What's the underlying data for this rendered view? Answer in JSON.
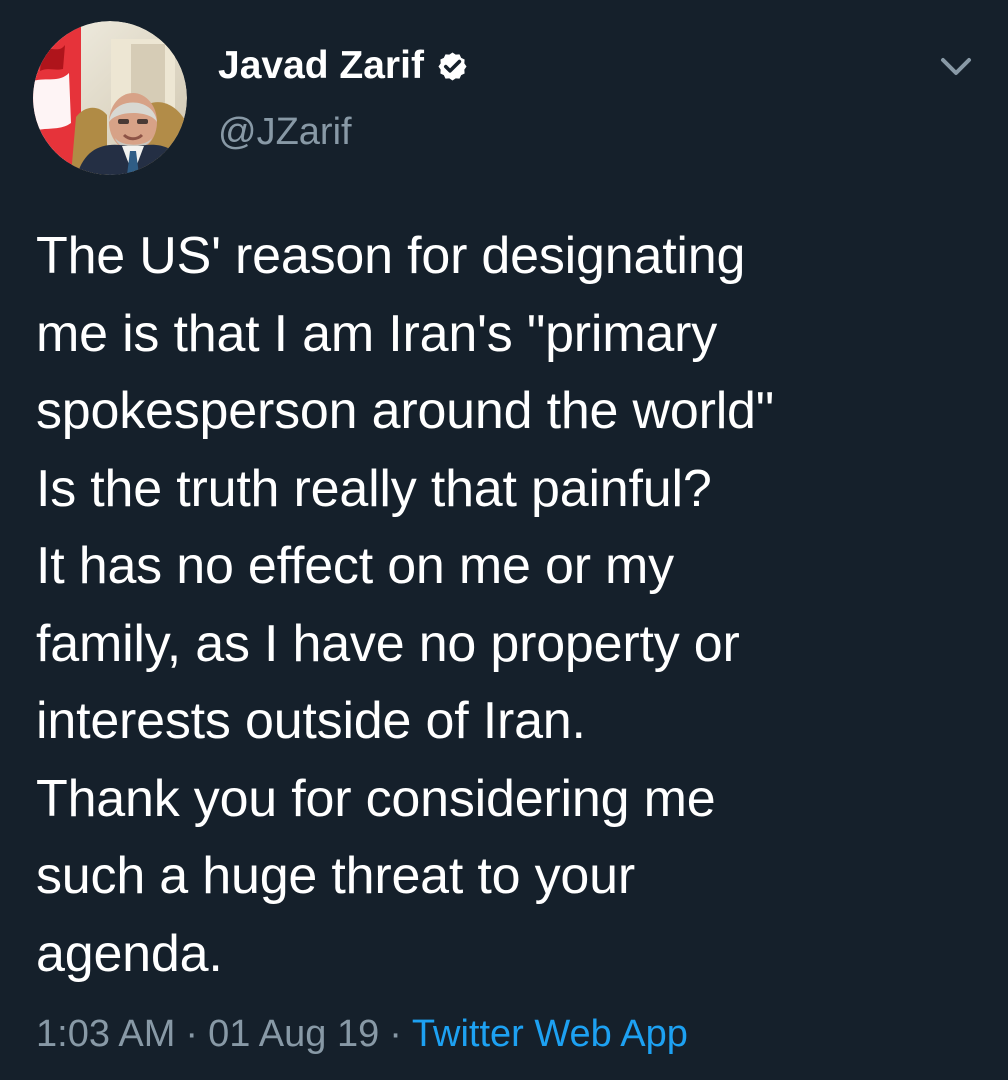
{
  "colors": {
    "background": "#15202b",
    "primary_text": "#ffffff",
    "secondary_text": "#8899a6",
    "link": "#1da1f2"
  },
  "tweet": {
    "author": {
      "display_name": "Javad Zarif",
      "handle": "@JZarif",
      "verified_icon": "verified-badge-icon",
      "avatar": "profile-photo-avatar"
    },
    "menu_icon": "chevron-down-icon",
    "text_lines": [
      "The US' reason for designating",
      "me is that I am Iran's \"primary",
      "spokesperson around the world\"",
      "Is the truth really that painful?",
      "It has no effect on me or my",
      "family, as I have no property or",
      "interests outside of Iran.",
      "Thank you for considering me",
      "such a huge threat to your",
      "agenda."
    ],
    "meta": {
      "time": "1:03 AM",
      "separator": "·",
      "date": "01 Aug 19",
      "source": "Twitter Web App"
    }
  }
}
